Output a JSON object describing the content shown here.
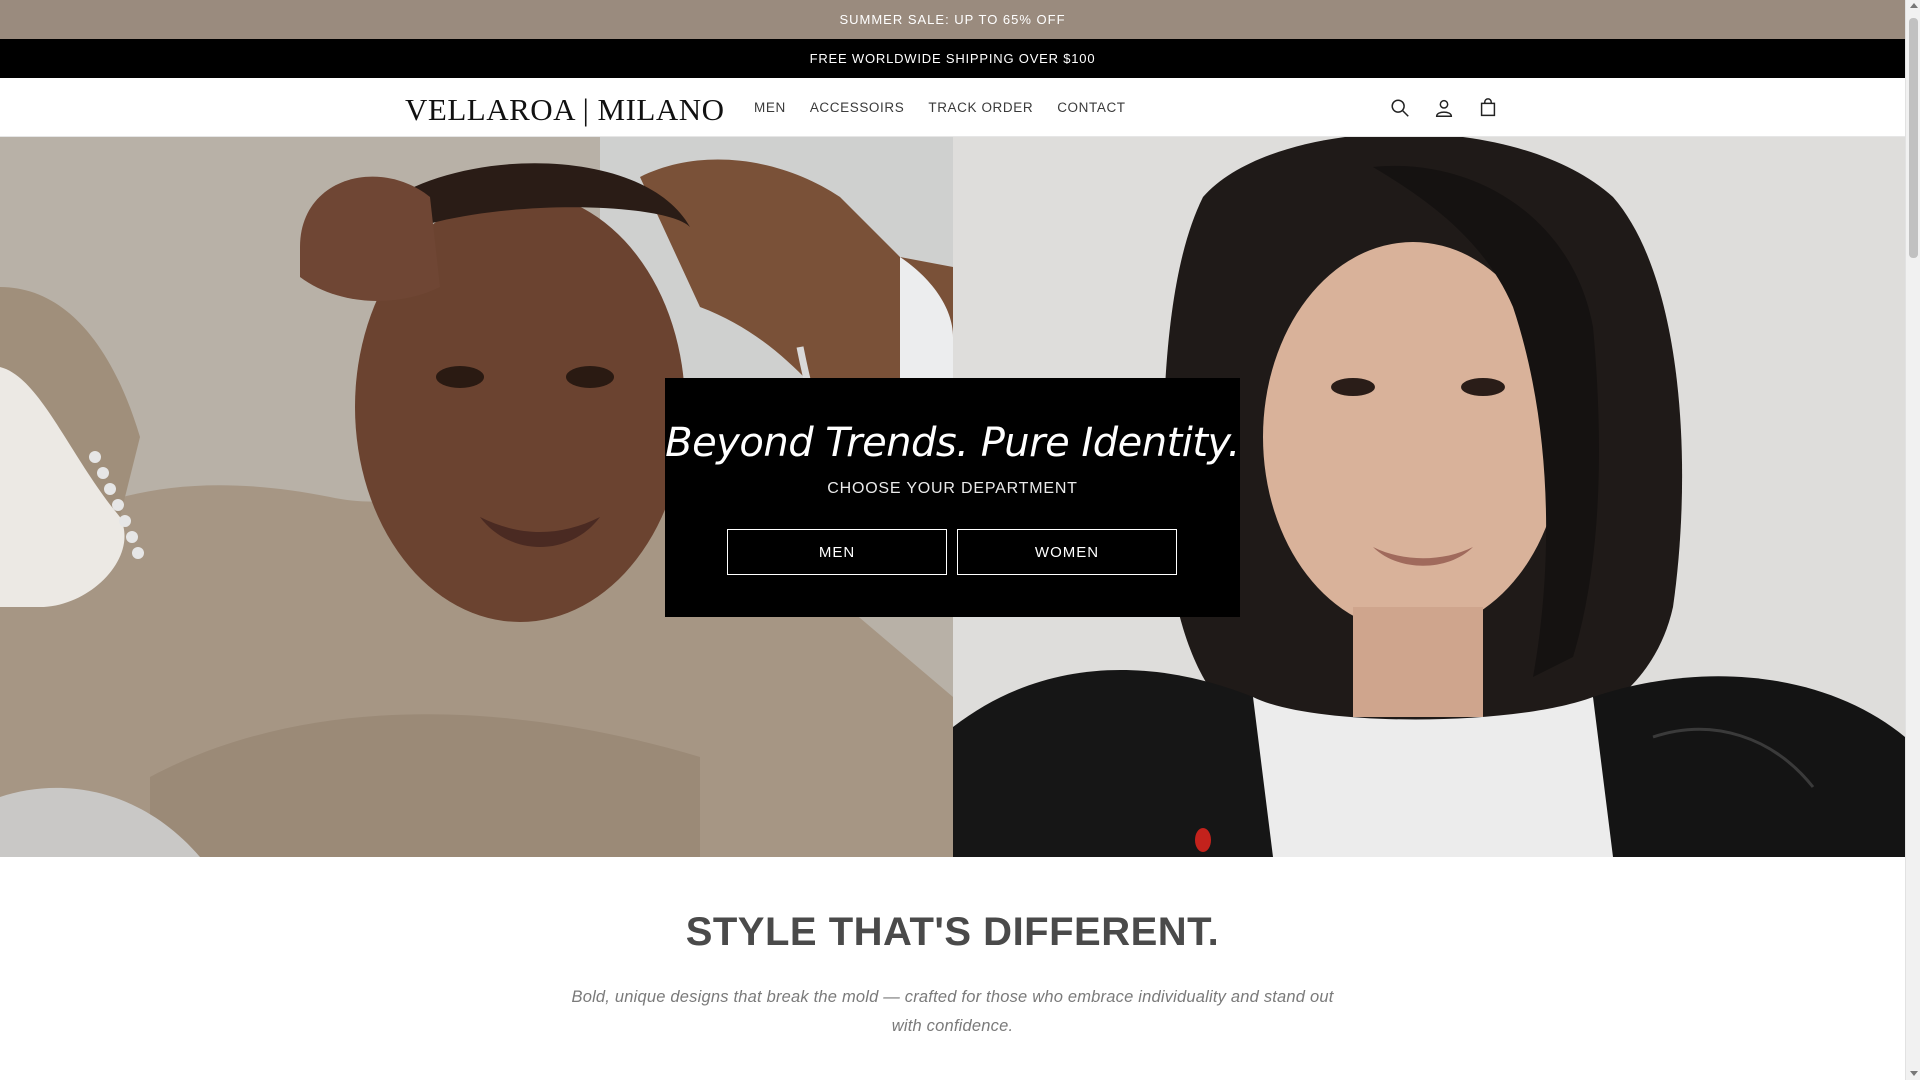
{
  "announcements": {
    "sale": "SUMMER SALE: UP TO 65% OFF",
    "shipping": "FREE WORLDWIDE SHIPPING OVER $100"
  },
  "header": {
    "logo": "VELLAROA | MILANO",
    "nav": [
      {
        "label": "MEN"
      },
      {
        "label": "ACCESSOIRS"
      },
      {
        "label": "TRACK ORDER"
      },
      {
        "label": "CONTACT"
      }
    ],
    "icons": [
      "search-icon",
      "account-icon",
      "cart-icon"
    ]
  },
  "hero": {
    "headline": "Beyond Trends. Pure Identity.",
    "subheadline": "CHOOSE YOUR DEPARTMENT",
    "buttons": {
      "men": "MEN",
      "women": "WOMEN"
    }
  },
  "section": {
    "title": "STYLE THAT'S DIFFERENT.",
    "body": "Bold, unique designs that break the mold — crafted for those who embrace individuality and stand out with confidence."
  },
  "colors": {
    "sale_bar": "#9a8b7e",
    "shipping_bar": "#000000",
    "overlay": "#000000"
  }
}
